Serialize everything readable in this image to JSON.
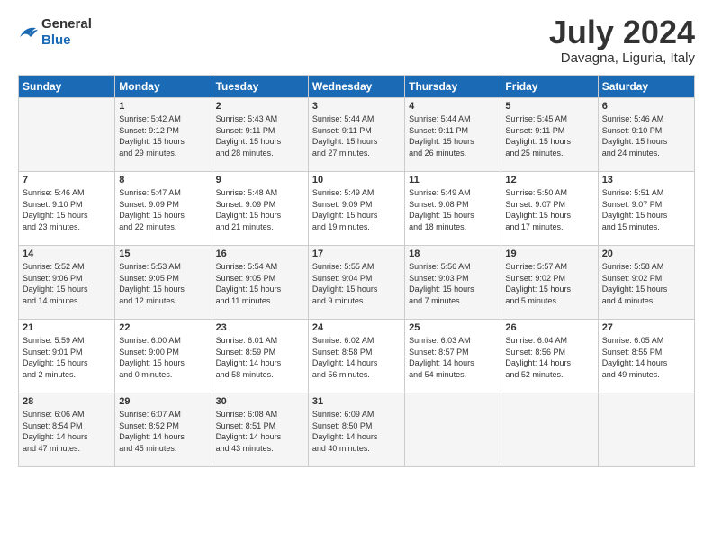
{
  "logo": {
    "general": "General",
    "blue": "Blue"
  },
  "title": "July 2024",
  "location": "Davagna, Liguria, Italy",
  "days_header": [
    "Sunday",
    "Monday",
    "Tuesday",
    "Wednesday",
    "Thursday",
    "Friday",
    "Saturday"
  ],
  "weeks": [
    [
      {
        "day": "",
        "content": ""
      },
      {
        "day": "1",
        "content": "Sunrise: 5:42 AM\nSunset: 9:12 PM\nDaylight: 15 hours\nand 29 minutes."
      },
      {
        "day": "2",
        "content": "Sunrise: 5:43 AM\nSunset: 9:11 PM\nDaylight: 15 hours\nand 28 minutes."
      },
      {
        "day": "3",
        "content": "Sunrise: 5:44 AM\nSunset: 9:11 PM\nDaylight: 15 hours\nand 27 minutes."
      },
      {
        "day": "4",
        "content": "Sunrise: 5:44 AM\nSunset: 9:11 PM\nDaylight: 15 hours\nand 26 minutes."
      },
      {
        "day": "5",
        "content": "Sunrise: 5:45 AM\nSunset: 9:11 PM\nDaylight: 15 hours\nand 25 minutes."
      },
      {
        "day": "6",
        "content": "Sunrise: 5:46 AM\nSunset: 9:10 PM\nDaylight: 15 hours\nand 24 minutes."
      }
    ],
    [
      {
        "day": "7",
        "content": "Sunrise: 5:46 AM\nSunset: 9:10 PM\nDaylight: 15 hours\nand 23 minutes."
      },
      {
        "day": "8",
        "content": "Sunrise: 5:47 AM\nSunset: 9:09 PM\nDaylight: 15 hours\nand 22 minutes."
      },
      {
        "day": "9",
        "content": "Sunrise: 5:48 AM\nSunset: 9:09 PM\nDaylight: 15 hours\nand 21 minutes."
      },
      {
        "day": "10",
        "content": "Sunrise: 5:49 AM\nSunset: 9:09 PM\nDaylight: 15 hours\nand 19 minutes."
      },
      {
        "day": "11",
        "content": "Sunrise: 5:49 AM\nSunset: 9:08 PM\nDaylight: 15 hours\nand 18 minutes."
      },
      {
        "day": "12",
        "content": "Sunrise: 5:50 AM\nSunset: 9:07 PM\nDaylight: 15 hours\nand 17 minutes."
      },
      {
        "day": "13",
        "content": "Sunrise: 5:51 AM\nSunset: 9:07 PM\nDaylight: 15 hours\nand 15 minutes."
      }
    ],
    [
      {
        "day": "14",
        "content": "Sunrise: 5:52 AM\nSunset: 9:06 PM\nDaylight: 15 hours\nand 14 minutes."
      },
      {
        "day": "15",
        "content": "Sunrise: 5:53 AM\nSunset: 9:05 PM\nDaylight: 15 hours\nand 12 minutes."
      },
      {
        "day": "16",
        "content": "Sunrise: 5:54 AM\nSunset: 9:05 PM\nDaylight: 15 hours\nand 11 minutes."
      },
      {
        "day": "17",
        "content": "Sunrise: 5:55 AM\nSunset: 9:04 PM\nDaylight: 15 hours\nand 9 minutes."
      },
      {
        "day": "18",
        "content": "Sunrise: 5:56 AM\nSunset: 9:03 PM\nDaylight: 15 hours\nand 7 minutes."
      },
      {
        "day": "19",
        "content": "Sunrise: 5:57 AM\nSunset: 9:02 PM\nDaylight: 15 hours\nand 5 minutes."
      },
      {
        "day": "20",
        "content": "Sunrise: 5:58 AM\nSunset: 9:02 PM\nDaylight: 15 hours\nand 4 minutes."
      }
    ],
    [
      {
        "day": "21",
        "content": "Sunrise: 5:59 AM\nSunset: 9:01 PM\nDaylight: 15 hours\nand 2 minutes."
      },
      {
        "day": "22",
        "content": "Sunrise: 6:00 AM\nSunset: 9:00 PM\nDaylight: 15 hours\nand 0 minutes."
      },
      {
        "day": "23",
        "content": "Sunrise: 6:01 AM\nSunset: 8:59 PM\nDaylight: 14 hours\nand 58 minutes."
      },
      {
        "day": "24",
        "content": "Sunrise: 6:02 AM\nSunset: 8:58 PM\nDaylight: 14 hours\nand 56 minutes."
      },
      {
        "day": "25",
        "content": "Sunrise: 6:03 AM\nSunset: 8:57 PM\nDaylight: 14 hours\nand 54 minutes."
      },
      {
        "day": "26",
        "content": "Sunrise: 6:04 AM\nSunset: 8:56 PM\nDaylight: 14 hours\nand 52 minutes."
      },
      {
        "day": "27",
        "content": "Sunrise: 6:05 AM\nSunset: 8:55 PM\nDaylight: 14 hours\nand 49 minutes."
      }
    ],
    [
      {
        "day": "28",
        "content": "Sunrise: 6:06 AM\nSunset: 8:54 PM\nDaylight: 14 hours\nand 47 minutes."
      },
      {
        "day": "29",
        "content": "Sunrise: 6:07 AM\nSunset: 8:52 PM\nDaylight: 14 hours\nand 45 minutes."
      },
      {
        "day": "30",
        "content": "Sunrise: 6:08 AM\nSunset: 8:51 PM\nDaylight: 14 hours\nand 43 minutes."
      },
      {
        "day": "31",
        "content": "Sunrise: 6:09 AM\nSunset: 8:50 PM\nDaylight: 14 hours\nand 40 minutes."
      },
      {
        "day": "",
        "content": ""
      },
      {
        "day": "",
        "content": ""
      },
      {
        "day": "",
        "content": ""
      }
    ]
  ]
}
